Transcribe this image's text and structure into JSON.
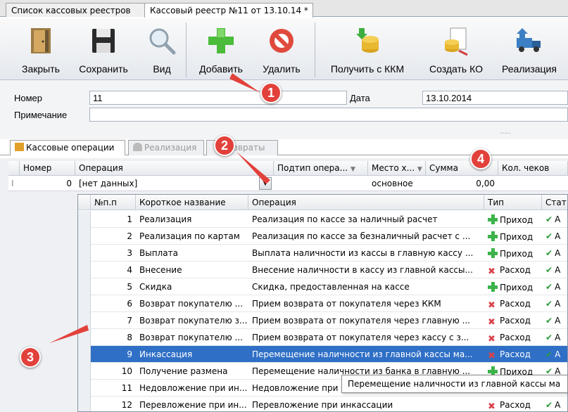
{
  "doc_tabs": [
    "Список кассовых реестров",
    "Кассовый реестр №11 от 13.10.14 *"
  ],
  "toolbar": {
    "close": "Закрыть",
    "save": "Сохранить",
    "view": "Вид",
    "add": "Добавить",
    "delete": "Удалить",
    "get_kkm": "Получить с ККМ",
    "create_ko": "Создать КО",
    "realization": "Реализация"
  },
  "form": {
    "number_label": "Номер",
    "number_value": "11",
    "date_label": "Дата",
    "date_value": "13.10.2014",
    "note_label": "Примечание",
    "note_value": "",
    "splitter": "....."
  },
  "sub_tabs": [
    "Кассовые операции",
    "Реализация",
    "Возвраты"
  ],
  "grid": {
    "headers": [
      "Номер",
      "Операция",
      "Подтип опера...",
      "Место х...",
      "Сумма",
      "Кол. чеков"
    ],
    "row": {
      "marker": "I",
      "number": "0",
      "operation": "[нет данных]",
      "place": "основное",
      "sum": "0,00"
    }
  },
  "dropdown": {
    "headers": [
      "№п.п",
      "Короткое название",
      "Операция",
      "Тип",
      "Стат"
    ],
    "rows": [
      {
        "n": "1",
        "short": "Реализация",
        "op": "Реализация по кассе за наличный расчет",
        "type": "Приход",
        "kind": "in"
      },
      {
        "n": "2",
        "short": "Реализация по картам",
        "op": "Реализация по кассе за безналичный расчет с ...",
        "type": "Приход",
        "kind": "in"
      },
      {
        "n": "3",
        "short": "Выплата",
        "op": "Выплата наличности из кассы в главную кассу ...",
        "type": "Приход",
        "kind": "in"
      },
      {
        "n": "4",
        "short": "Внесение",
        "op": "Внесение наличности в кассу из главной кассы...",
        "type": "Расход",
        "kind": "out"
      },
      {
        "n": "5",
        "short": "Скидка",
        "op": "Скидка, предоставленная на кассе",
        "type": "Приход",
        "kind": "in"
      },
      {
        "n": "6",
        "short": "Возврат покупателю ...",
        "op": "Прием возврата от покупателя через ККМ",
        "type": "Расход",
        "kind": "out"
      },
      {
        "n": "7",
        "short": "Возврат покупателю з...",
        "op": "Прием возврата от покупателя через главную ...",
        "type": "Расход",
        "kind": "out"
      },
      {
        "n": "8",
        "short": "Возврат покупателю ...",
        "op": "Прием возврата от покупателя через кассу с з...",
        "type": "Расход",
        "kind": "out"
      },
      {
        "n": "9",
        "short": "Инкассация",
        "op": "Перемещение наличности из главной кассы ма...",
        "type": "Расход",
        "kind": "out"
      },
      {
        "n": "10",
        "short": "Получение размена",
        "op": "Перемещение наличности из банка в главную ...",
        "type": "Приход",
        "kind": "in"
      },
      {
        "n": "11",
        "short": "Недовложение при ин...",
        "op": "Недовложение при",
        "type": "",
        "kind": ""
      },
      {
        "n": "12",
        "short": "Перевложение при ин...",
        "op": "Перевложение при инкассации",
        "type": "Расход",
        "kind": "out"
      }
    ],
    "selected_index": 8,
    "status_mark": "А"
  },
  "tooltip": "Перемещение наличности из главной кассы ма",
  "callouts": [
    "1",
    "2",
    "3",
    "4"
  ],
  "colors": {
    "accent": "#2f6fc6",
    "callout": "#e2413b",
    "income": "#3cb34a",
    "expense": "#d9434b"
  }
}
